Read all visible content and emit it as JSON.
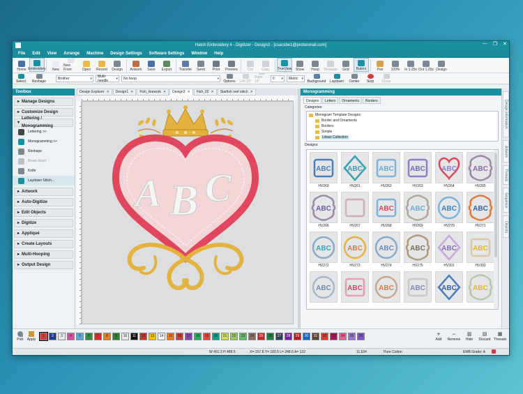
{
  "window": {
    "title": "Hatch Embroidery 4 - Digitizer - Design3 - [csacsbe1@protonmail.com]",
    "controls": [
      "—",
      "❐",
      "✕"
    ]
  },
  "menu": [
    "File",
    "Edit",
    "View",
    "Arrange",
    "Machine",
    "Design Settings",
    "Software Settings",
    "Window",
    "Help"
  ],
  "ribbon": {
    "buttons": [
      {
        "label": "Home",
        "icon": "home-icon",
        "color": "#4a6fa5"
      },
      {
        "label": "Embroidery",
        "icon": "embroidery-icon",
        "color": "#1a8f9f",
        "active": true
      },
      {
        "label": "New",
        "icon": "new-file-icon",
        "color": "#e8edf1"
      },
      {
        "label": "New From",
        "icon": "new-from-icon",
        "color": "#dfe6ea"
      },
      {
        "label": "Open",
        "icon": "open-folder-icon",
        "color": "#e8b947"
      },
      {
        "label": "Recent",
        "icon": "recent-icon",
        "color": "#e8b947"
      },
      {
        "label": "Design",
        "icon": "design-icon",
        "color": "#7b8791"
      },
      {
        "label": "Artwork",
        "icon": "artwork-icon",
        "color": "#c06f3c"
      },
      {
        "label": "Save",
        "icon": "save-icon",
        "color": "#4a6fa5"
      },
      {
        "label": "Export",
        "icon": "export-icon",
        "color": "#5c8a5e"
      },
      {
        "label": "Transfer",
        "icon": "transfer-icon",
        "color": "#5b7fa5"
      },
      {
        "label": "Send",
        "icon": "send-icon",
        "color": "#7b8791"
      },
      {
        "label": "Print",
        "icon": "print-icon",
        "color": "#6e7b86"
      },
      {
        "label": "Preview",
        "icon": "preview-icon",
        "color": "#6e7b86"
      },
      {
        "label": "Cut",
        "icon": "cut-icon",
        "color": "#aaa",
        "disabled": true
      },
      {
        "label": "Copy",
        "icon": "copy-icon",
        "color": "#aaa",
        "disabled": true
      },
      {
        "label": "TrueView",
        "icon": "trueview-icon",
        "color": "#1a8f9f",
        "active": true
      },
      {
        "label": "Show",
        "icon": "show-icon",
        "color": "#7b8791"
      },
      {
        "label": "Hoop",
        "icon": "hoop-icon",
        "color": "#7b8791"
      },
      {
        "label": "Template",
        "icon": "template-icon",
        "color": "#aaa",
        "disabled": true
      },
      {
        "label": "Grid",
        "icon": "grid-icon",
        "color": "#7b8791"
      },
      {
        "label": "Rulers",
        "icon": "rulers-icon",
        "color": "#1a8f9f",
        "active": true
      },
      {
        "label": "Pan",
        "icon": "pan-icon",
        "color": "#d4a04a"
      },
      {
        "label": "100%",
        "icon": "zoom-100-icon",
        "color": "#7b8791"
      },
      {
        "label": "In 1.25x",
        "icon": "zoom-in-icon",
        "color": "#7b8791"
      },
      {
        "label": "Out 1.25x",
        "icon": "zoom-out-icon",
        "color": "#7b8791"
      },
      {
        "label": "Design",
        "icon": "zoom-design-icon",
        "color": "#7b8791"
      }
    ],
    "row2": {
      "select_label": "Select",
      "reshape_label": "Reshape",
      "machine": "Brother",
      "needle": "Multi-needle",
      "hoop": "No hoop",
      "options_label": "Options",
      "left_label": "Left 15°",
      "right_label": "Right 15°",
      "rotate_value": "0",
      "units": "Metric",
      "background_label": "Background",
      "laydown_label": "Laydown",
      "center_label": "Center",
      "stop_label": "Stop",
      "close_label": "Close"
    }
  },
  "toolbox": {
    "title": "Toolbox",
    "groups": [
      {
        "label": "Manage Designs",
        "open": false
      },
      {
        "label": "Customize Design",
        "open": false
      },
      {
        "label": "Lettering / Monogramming",
        "open": true
      }
    ],
    "lettering_items": [
      {
        "label": "Lettering >>",
        "icon": "lettering-icon",
        "color": "#444",
        "disabled": false
      },
      {
        "label": "Monogramming >>",
        "icon": "monogram-icon",
        "color": "#1a8f9f",
        "disabled": false
      },
      {
        "label": "Reshape",
        "icon": "reshape-icon",
        "color": "#7b8791",
        "disabled": false
      },
      {
        "label": "Break Apart",
        "icon": "break-apart-icon",
        "color": "#b8c0c6",
        "disabled": true
      },
      {
        "label": "Knife",
        "icon": "knife-icon",
        "color": "#7b8791",
        "disabled": false
      },
      {
        "label": "Laydown Stitch...",
        "icon": "laydown-stitch-icon",
        "color": "#1a8f9f",
        "disabled": false
      }
    ],
    "more_groups": [
      "Artwork",
      "Auto-Digitize",
      "Edit Objects",
      "Digitize",
      "Appliqué",
      "Create Layouts",
      "Multi-Hooping",
      "Output Design"
    ]
  },
  "doc_tabs": [
    {
      "label": "Design Explorer",
      "closable": true,
      "active": false
    },
    {
      "label": "Design1",
      "closable": true,
      "active": false
    },
    {
      "label": "Fish_linework",
      "closable": true,
      "active": false
    },
    {
      "label": "Design3",
      "closable": true,
      "active": true
    },
    {
      "label": "Fish_02",
      "closable": true,
      "active": false
    },
    {
      "label": "Starfish reef stitch",
      "closable": true,
      "active": false
    }
  ],
  "canvas": {
    "monogram_letters": [
      "A",
      "B",
      "C"
    ],
    "colors": {
      "gold": "#e3b33d",
      "heart": "#e0475e",
      "white_satin": "#f5f5f3",
      "background": "#dcdedf"
    }
  },
  "monogramming": {
    "title": "Monogramming",
    "tabs": [
      "Designs",
      "Letters",
      "Ornaments",
      "Borders"
    ],
    "categories_label": "Categories:",
    "tree": [
      {
        "label": "Monogram Template Designs",
        "level": 1
      },
      {
        "label": "Border and Ornaments",
        "level": 2
      },
      {
        "label": "Borders",
        "level": 2
      },
      {
        "label": "Simple",
        "level": 2
      },
      {
        "label": "Urban Collection",
        "level": 2,
        "selected": true
      }
    ],
    "designs_label": "Designs:",
    "designs": [
      {
        "code": "HV260",
        "frame": "#4a7fb8",
        "text": "ABC",
        "textcolor": "#4a7fb8",
        "shape": "rect"
      },
      {
        "code": "HV261",
        "frame": "#3a9fb0",
        "text": "ABC",
        "textcolor": "#3a9fb0",
        "shape": "diamond"
      },
      {
        "code": "HV262",
        "frame": "#7fb3d8",
        "text": "ABC",
        "textcolor": "#6aa8cf",
        "shape": "rect"
      },
      {
        "code": "HV263",
        "frame": "#8a7fc8",
        "text": "ABC",
        "textcolor": "#6f6ab8",
        "shape": "rect"
      },
      {
        "code": "HV264",
        "frame": "#e0475e",
        "text": "ABC",
        "textcolor": "#8a7fc8",
        "shape": "heart"
      },
      {
        "code": "HV265",
        "frame": "#9a8aa6",
        "text": "ABC",
        "textcolor": "#8a6aa6",
        "shape": "ornate"
      },
      {
        "code": "HV266",
        "frame": "#9a8aa6",
        "text": "ABC",
        "textcolor": "#6a5aa8",
        "shape": "ornate"
      },
      {
        "code": "HV267",
        "frame": "#d0b0b4",
        "text": "",
        "textcolor": "#d0b0b4",
        "shape": "rect"
      },
      {
        "code": "HV268",
        "frame": "#7fb3d8",
        "text": "ABC",
        "textcolor": "#e0475e",
        "shape": "rect"
      },
      {
        "code": "HV269",
        "frame": "#b0a89a",
        "text": "ABC",
        "textcolor": "#6aa8cf",
        "shape": "ornate"
      },
      {
        "code": "HV270",
        "frame": "#7fb3d8",
        "text": "ABC",
        "textcolor": "#3a7fb8",
        "shape": "circle"
      },
      {
        "code": "HV271",
        "frame": "#e07a3d",
        "text": "ABC",
        "textcolor": "#3a5fa8",
        "shape": "ornate"
      },
      {
        "code": "HV272",
        "frame": "#8aa8c8",
        "text": "ABC",
        "textcolor": "#3a9fb0",
        "shape": "circle"
      },
      {
        "code": "HV273",
        "frame": "#e3b33d",
        "text": "ABC",
        "textcolor": "#e07a3d",
        "shape": "circle"
      },
      {
        "code": "HV274",
        "frame": "#8aa8c8",
        "text": "ABC",
        "textcolor": "#6a8ab8",
        "shape": "circle"
      },
      {
        "code": "HV275",
        "frame": "#b09a7a",
        "text": "ABC",
        "textcolor": "#7a6a5a",
        "shape": "ornate"
      },
      {
        "code": "HV301",
        "frame": "#c8a8d8",
        "text": "ABC",
        "textcolor": "#8a6ab8",
        "shape": "diamond"
      },
      {
        "code": "HV302",
        "frame": "#d8c8a8",
        "text": "ABC",
        "textcolor": "#e3b33d",
        "shape": "rect"
      },
      {
        "code": "",
        "frame": "#a8b8c8",
        "text": "ABC",
        "textcolor": "#6a8ab8",
        "shape": "circle"
      },
      {
        "code": "",
        "frame": "#e0a0b0",
        "text": "ABC",
        "textcolor": "#e0475e",
        "shape": "rect"
      },
      {
        "code": "",
        "frame": "#c8a890",
        "text": "ABC",
        "textcolor": "#e07a3d",
        "shape": "circle"
      },
      {
        "code": "",
        "frame": "#c8c8c8",
        "text": "ABC",
        "textcolor": "#7a8ab8",
        "shape": "rect"
      },
      {
        "code": "",
        "frame": "#4a7fb8",
        "text": "ABC",
        "textcolor": "#3a5fa8",
        "shape": "diamond"
      },
      {
        "code": "",
        "frame": "#b8c8a8",
        "text": "ABC",
        "textcolor": "#e3b33d",
        "shape": "ornate"
      }
    ]
  },
  "side_tabs": [
    "Design information",
    "Artwork",
    "Threads",
    "Sequence",
    "Objects"
  ],
  "colorbar": {
    "pick_label": "Pick",
    "apply_label": "Apply",
    "swatches": [
      {
        "n": "1",
        "color": "#d63b3b"
      },
      {
        "n": "2",
        "color": "#1f3d8f"
      },
      {
        "n": "3",
        "color": "#e6e6e6"
      },
      {
        "n": "4",
        "color": "#d44fa0"
      },
      {
        "n": "5",
        "color": "#5aa8e0"
      },
      {
        "n": "6",
        "color": "#2f8f4a"
      },
      {
        "n": "7",
        "color": "#c0392b"
      },
      {
        "n": "8",
        "color": "#e67e22"
      },
      {
        "n": "9",
        "color": "#2e7d32"
      },
      {
        "n": "10",
        "color": "#e8e8e8"
      },
      {
        "n": "11",
        "color": "#111111"
      },
      {
        "n": "12",
        "color": "#c0392b"
      },
      {
        "n": "13",
        "color": "#f1c40f"
      },
      {
        "n": "14",
        "color": "#f5f5f5"
      },
      {
        "n": "15",
        "color": "#e67e22"
      },
      {
        "n": "16",
        "color": "#d63b3b"
      },
      {
        "n": "17",
        "color": "#8e44ad"
      },
      {
        "n": "18",
        "color": "#27ae60"
      },
      {
        "n": "19",
        "color": "#e74c3c"
      },
      {
        "n": "20",
        "color": "#16a085"
      },
      {
        "n": "21",
        "color": "#d4e157"
      },
      {
        "n": "22",
        "color": "#9ccc65"
      },
      {
        "n": "23",
        "color": "#66bb6a"
      },
      {
        "n": "24",
        "color": "#8d6e63"
      },
      {
        "n": "25",
        "color": "#c62828"
      },
      {
        "n": "26",
        "color": "#1e8449"
      },
      {
        "n": "27",
        "color": "#2e4057"
      },
      {
        "n": "28",
        "color": "#7b1fa2"
      },
      {
        "n": "29",
        "color": "#b71c1c"
      },
      {
        "n": "30",
        "color": "#1565c0"
      },
      {
        "n": "31",
        "color": "#5d4037"
      },
      {
        "n": "32",
        "color": "#e53935"
      },
      {
        "n": "33",
        "color": "#ad1457"
      },
      {
        "n": "34",
        "color": "#f06292"
      },
      {
        "n": "35",
        "color": "#9575cd"
      },
      {
        "n": "36",
        "color": "#7e57c2"
      }
    ],
    "add_label": "Add",
    "remove_label": "Remove",
    "hide_label": "Hide",
    "discard_label": "Discard",
    "threads_label": "Threads"
  },
  "status": {
    "size": "W 401.3 H 488.5",
    "coords": "X=-167.8 Y= 183.5 L= 248.6 A= 132",
    "stitches": "11,634",
    "fabric": "Pure Cotton",
    "grade": "EMB Grade: A"
  }
}
